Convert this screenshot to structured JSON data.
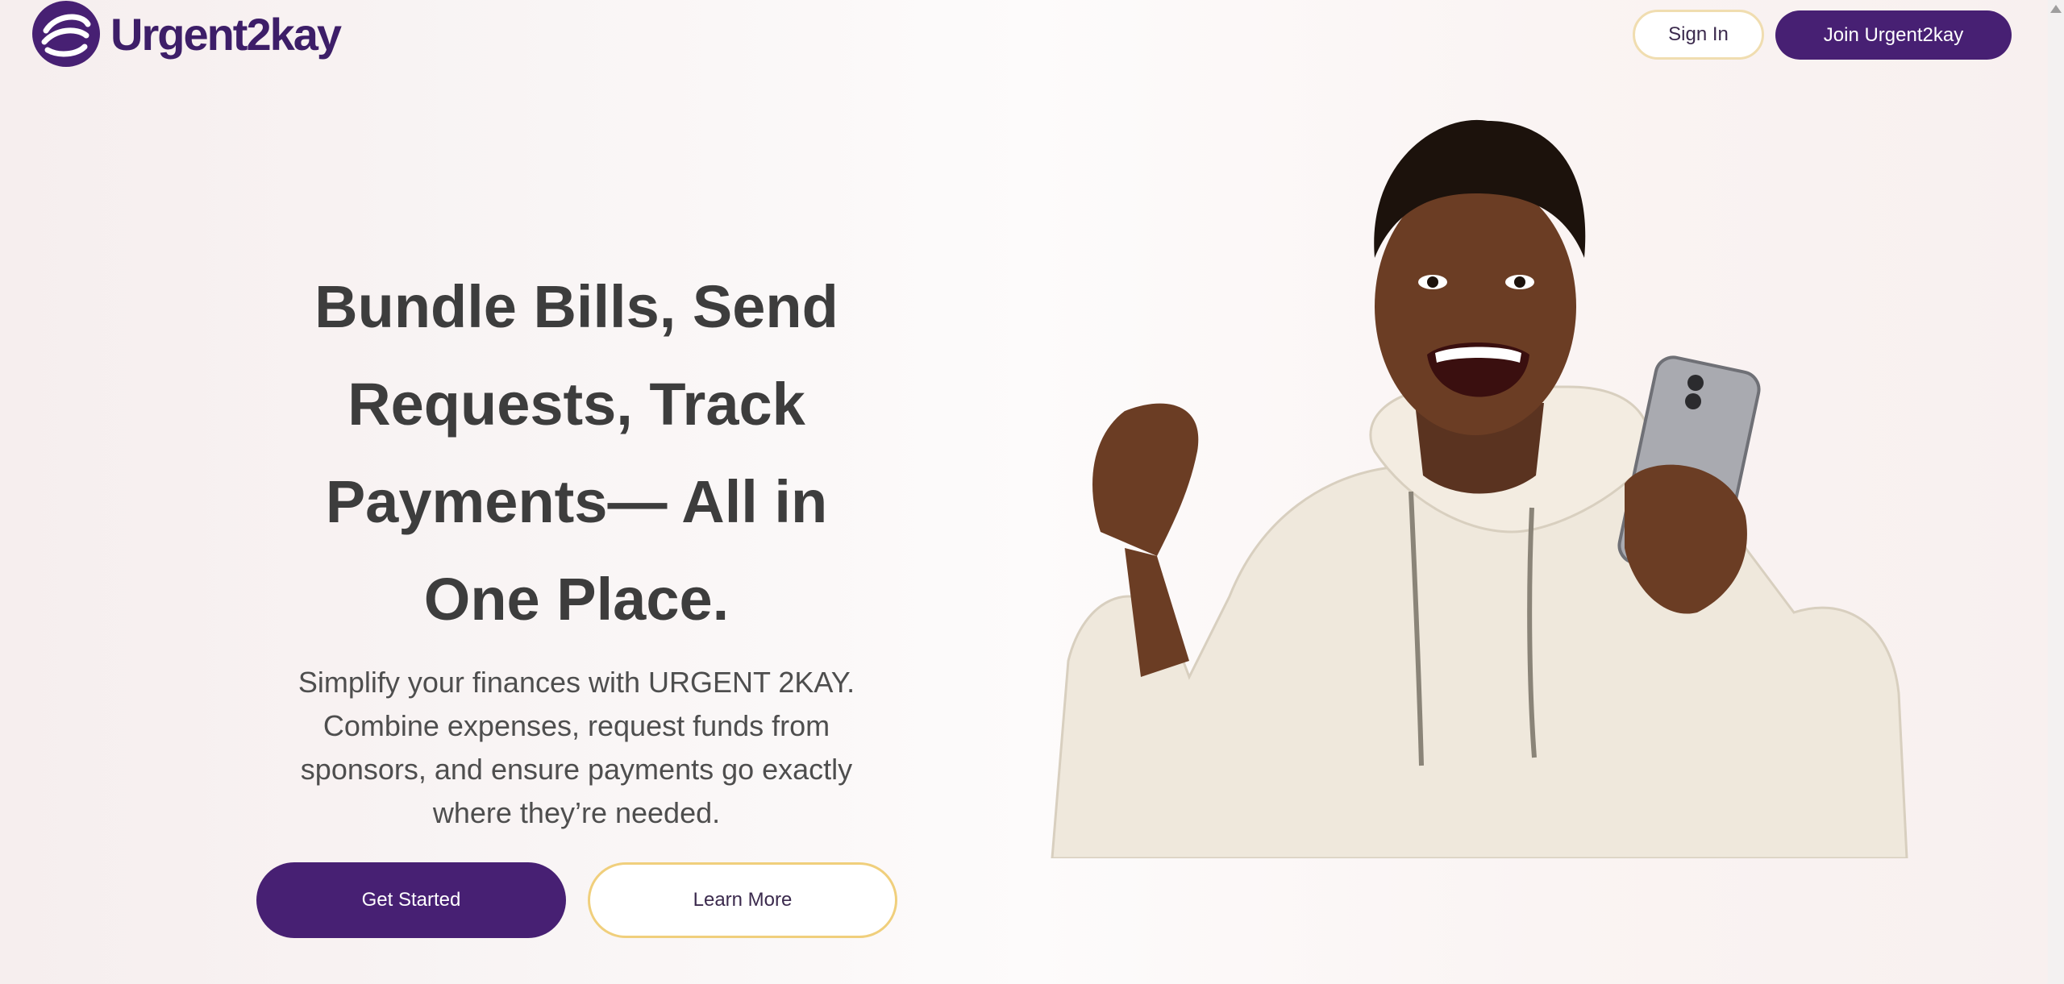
{
  "header": {
    "brand_name": "Urgent2kay",
    "signin_label": "Sign In",
    "join_label": "Join Urgent2kay"
  },
  "hero": {
    "title_lines": [
      "Bundle Bills, Send",
      "Requests, Track",
      "Payments— All in",
      "One Place."
    ],
    "subtitle_lines": [
      "Simplify your finances with URGENT 2KAY.",
      "Combine expenses, request funds from",
      "sponsors, and ensure payments go exactly",
      "where they’re needed."
    ],
    "get_started_label": "Get Started",
    "learn_more_label": "Learn More"
  },
  "colors": {
    "brand_purple": "#472073",
    "accent_gold": "#f0cf7c",
    "heading": "#3d3d3d",
    "body": "#4e4e4e"
  },
  "icons": {
    "logo": "brand-logo-icon",
    "scroll_up": "chevron-up-icon"
  }
}
